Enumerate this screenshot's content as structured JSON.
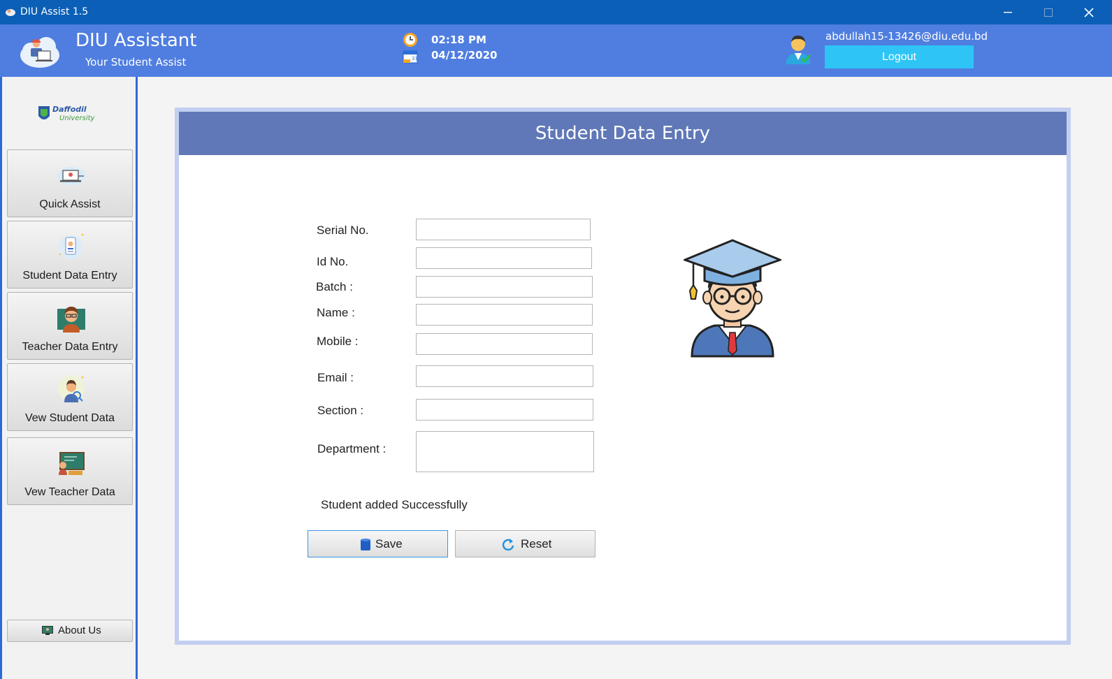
{
  "window": {
    "title": "DIU Assist 1.5",
    "minimize_glyph": "—",
    "close_glyph": "✕"
  },
  "header": {
    "app_name": "DIU Assistant",
    "app_subtitle": "Your Student Assist",
    "time": "02:18 PM",
    "date": "04/12/2020",
    "user_email": "abdullah15-13426@diu.edu.bd",
    "logout_label": "Logout",
    "logout_color": "#2ec4f5",
    "header_color": "#4f7ee0",
    "calendar_day": "31"
  },
  "sidebar": {
    "logo_text_top": "Daffodil",
    "logo_text_bottom": "University",
    "items": [
      {
        "label": "Quick Assist",
        "icon": "laptop-support-icon"
      },
      {
        "label": "Student Data Entry",
        "icon": "id-card-icon"
      },
      {
        "label": "Teacher Data Entry",
        "icon": "teacher-icon"
      },
      {
        "label": "Vew Student Data",
        "icon": "student-search-icon"
      },
      {
        "label": "Vew Teacher Data",
        "icon": "classroom-board-icon"
      }
    ],
    "about_label": "About Us"
  },
  "form": {
    "title": "Student Data Entry",
    "title_bar_color": "#6078b8",
    "fields": {
      "serial_label": "Serial No.",
      "id_label": "Id No.",
      "batch_label": "Batch :",
      "name_label": "Name :",
      "mobile_label": "Mobile :",
      "email_label": "Email :",
      "section_label": "Section :",
      "department_label": "Department :"
    },
    "values": {
      "serial": "",
      "id": "",
      "batch": "",
      "name": "",
      "mobile": "",
      "email": "",
      "section": "",
      "department": ""
    },
    "status_message": "Student added Successfully",
    "save_label": "Save",
    "reset_label": "Reset"
  }
}
